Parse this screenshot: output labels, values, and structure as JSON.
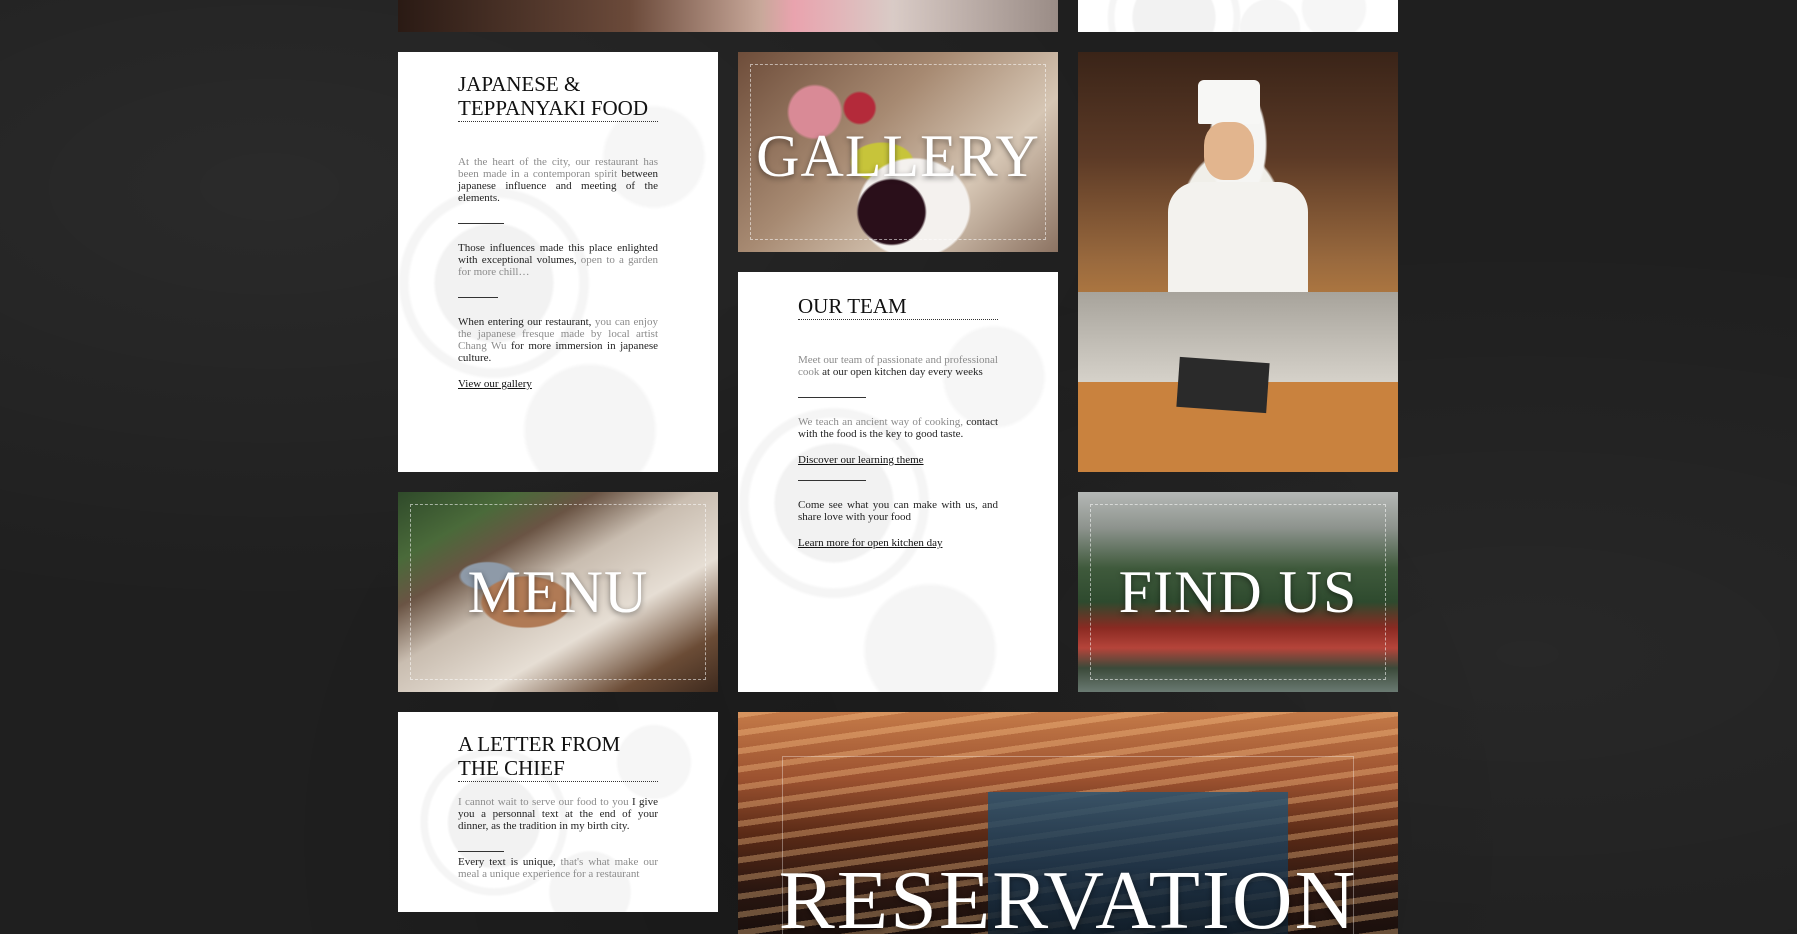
{
  "tiles": {
    "japanese": {
      "title_line1": "JAPANESE &",
      "title_line2": "TEPPANYAKI FOOD",
      "p1_gray": "At the heart of the city, our restaurant has been made in a contemporan spirit",
      "p1_dark": " between japanese influence and meeting of the elements.",
      "p2_dark": "Those influences made this place enlighted with exceptional volumes,",
      "p2_gray": " open to a garden for more chill…",
      "p3_dark": "When entering our restaurant,",
      "p3_gray": " you can enjoy the japanese fresque made by local artist Chang Wu",
      "p3_dark2": " for more immersion in japanese culture.",
      "link": "View our gallery"
    },
    "gallery": {
      "label": "GALLERY"
    },
    "team": {
      "title": "OUR TEAM",
      "p1_gray": "Meet our team of passionate and professional cook",
      "p1_dark": " at our open kitchen day every weeks",
      "p2_gray": "We teach an ancient way of cooking,",
      "p2_dark": " contact with the food is the key to good taste.",
      "link1": "Discover our learning theme",
      "p3_dark": "Come see what you can make with us, and share love with your food",
      "link2": "Learn more for open kitchen day"
    },
    "menu": {
      "label": "MENU"
    },
    "find_us": {
      "label": "FIND US"
    },
    "letter": {
      "title_line1": "A LETTER FROM",
      "title_line2": "THE CHIEF",
      "p1_gray": "I cannot wait to serve our food to you",
      "p1_dark": " I give you a personnal text at the end of your dinner, as the tradition in my birth city.",
      "p2_dark": "Every text is unique,",
      "p2_gray": " that's what make our meal a unique experience for a restaurant"
    },
    "reservation": {
      "label": "RESERVATION"
    }
  },
  "colors": {
    "background": "#1f1f1f",
    "card": "#ffffff",
    "text_dark": "#111111",
    "text_gray": "#8b8b8b"
  }
}
